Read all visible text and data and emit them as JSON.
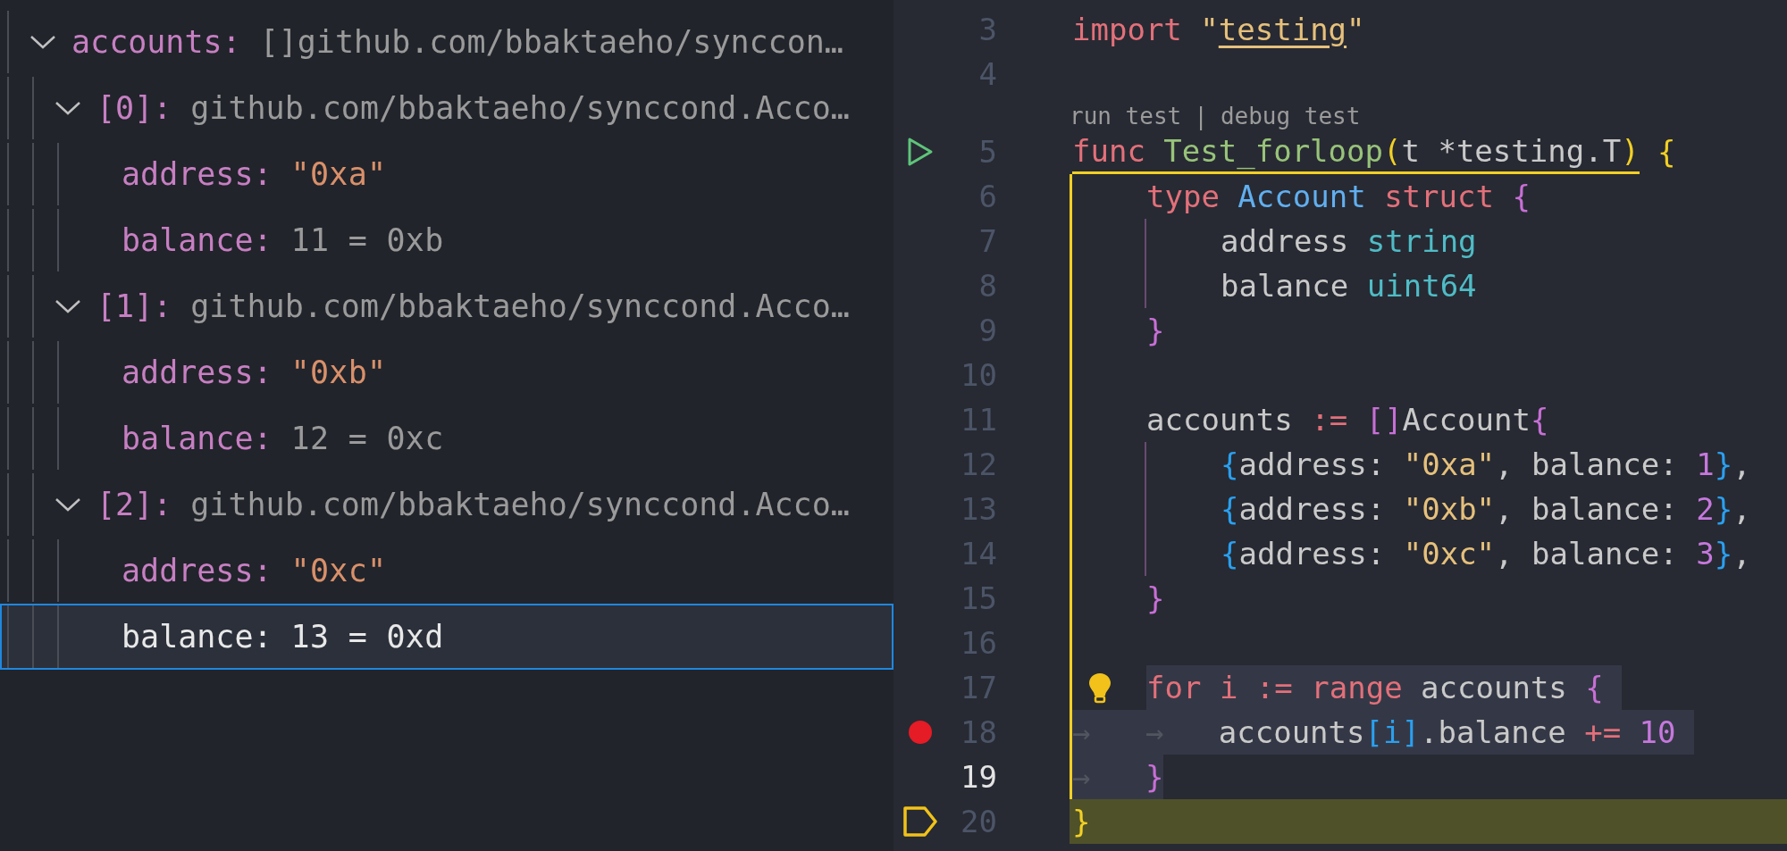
{
  "variables": [
    {
      "name": "accounts:",
      "value": "[]github.com/bbaktaeho/synccon…",
      "kind": "type",
      "expanded": true,
      "selected": false,
      "children": [
        {
          "name": "[0]:",
          "value": "github.com/bbaktaeho/synccond.Acco…",
          "kind": "type",
          "expanded": true,
          "selected": false,
          "children": [
            {
              "name": "address:",
              "value": "\"0xa\"",
              "kind": "string",
              "selected": false
            },
            {
              "name": "balance:",
              "value": "11 = 0xb",
              "kind": "number",
              "selected": false
            }
          ]
        },
        {
          "name": "[1]:",
          "value": "github.com/bbaktaeho/synccond.Acco…",
          "kind": "type",
          "expanded": true,
          "selected": false,
          "children": [
            {
              "name": "address:",
              "value": "\"0xb\"",
              "kind": "string",
              "selected": false
            },
            {
              "name": "balance:",
              "value": "12 = 0xc",
              "kind": "number",
              "selected": false
            }
          ]
        },
        {
          "name": "[2]:",
          "value": "github.com/bbaktaeho/synccond.Acco…",
          "kind": "type",
          "expanded": true,
          "selected": false,
          "children": [
            {
              "name": "address:",
              "value": "\"0xc\"",
              "kind": "string",
              "selected": false
            },
            {
              "name": "balance:",
              "value": "13 = 0xd",
              "kind": "number",
              "selected": true
            }
          ]
        }
      ]
    }
  ],
  "editor": {
    "lines": [
      {
        "number": "3",
        "tokens": [
          {
            "text": "import ",
            "kind": "keyword"
          },
          {
            "text": "\"",
            "kind": "string"
          },
          {
            "text": "testing",
            "kind": "link"
          },
          {
            "text": "\"",
            "kind": "string"
          }
        ]
      },
      {
        "number": "4"
      },
      {
        "number": "5",
        "kind": "run",
        "codelens": [
          "run test",
          "debug test"
        ],
        "codelens_separator": "|",
        "scope_start": true,
        "tokens": [
          {
            "text": "func ",
            "kind": "keyword"
          },
          {
            "text": "Test_forloop",
            "kind": "function"
          },
          {
            "text": "(",
            "kind": "paren"
          },
          {
            "text": "t *testing.T",
            "kind": "plain"
          },
          {
            "text": ")",
            "kind": "paren"
          },
          {
            "text": " {",
            "kind": "paren"
          }
        ],
        "children": [
          {
            "number": "6",
            "in_scope": true,
            "tokens": [
              {
                "text": "type ",
                "kind": "keyword"
              },
              {
                "text": "Account ",
                "kind": "type"
              },
              {
                "text": "struct ",
                "kind": "keyword"
              },
              {
                "text": "{",
                "kind": "brace"
              }
            ],
            "children": [
              {
                "number": "7",
                "in_scope": true,
                "tokens": [
                  {
                    "text": "address ",
                    "kind": "plain"
                  },
                  {
                    "text": "string",
                    "kind": "builtin"
                  }
                ]
              },
              {
                "number": "8",
                "in_scope": true,
                "tokens": [
                  {
                    "text": "balance ",
                    "kind": "plain"
                  },
                  {
                    "text": "uint64",
                    "kind": "builtin"
                  }
                ]
              }
            ]
          },
          {
            "number": "9",
            "in_scope": true,
            "tokens": [
              {
                "text": "}",
                "kind": "brace"
              }
            ]
          },
          {
            "number": "10",
            "in_scope": true
          },
          {
            "number": "11",
            "in_scope": true,
            "tokens": [
              {
                "text": "accounts ",
                "kind": "plain"
              },
              {
                "text": ":= ",
                "kind": "keyword"
              },
              {
                "text": "[]",
                "kind": "brace"
              },
              {
                "text": "Account",
                "kind": "plain"
              },
              {
                "text": "{",
                "kind": "brace"
              }
            ],
            "children": [
              {
                "number": "12",
                "in_scope": true,
                "tokens": [
                  {
                    "text": "{",
                    "kind": "bracket"
                  },
                  {
                    "text": "address: ",
                    "kind": "plain"
                  },
                  {
                    "text": "\"0xa\"",
                    "kind": "string"
                  },
                  {
                    "text": ", balance: ",
                    "kind": "plain"
                  },
                  {
                    "text": "1",
                    "kind": "number"
                  },
                  {
                    "text": "}",
                    "kind": "bracket"
                  },
                  {
                    "text": ",",
                    "kind": "plain"
                  }
                ]
              },
              {
                "number": "13",
                "in_scope": true,
                "tokens": [
                  {
                    "text": "{",
                    "kind": "bracket"
                  },
                  {
                    "text": "address: ",
                    "kind": "plain"
                  },
                  {
                    "text": "\"0xb\"",
                    "kind": "string"
                  },
                  {
                    "text": ", balance: ",
                    "kind": "plain"
                  },
                  {
                    "text": "2",
                    "kind": "number"
                  },
                  {
                    "text": "}",
                    "kind": "bracket"
                  },
                  {
                    "text": ",",
                    "kind": "plain"
                  }
                ]
              },
              {
                "number": "14",
                "in_scope": true,
                "tokens": [
                  {
                    "text": "{",
                    "kind": "bracket"
                  },
                  {
                    "text": "address: ",
                    "kind": "plain"
                  },
                  {
                    "text": "\"0xc\"",
                    "kind": "string"
                  },
                  {
                    "text": ", balance: ",
                    "kind": "plain"
                  },
                  {
                    "text": "3",
                    "kind": "number"
                  },
                  {
                    "text": "}",
                    "kind": "bracket"
                  },
                  {
                    "text": ",",
                    "kind": "plain"
                  }
                ]
              }
            ]
          },
          {
            "number": "15",
            "in_scope": true,
            "tokens": [
              {
                "text": "}",
                "kind": "brace"
              }
            ]
          },
          {
            "number": "16",
            "in_scope": true
          },
          {
            "number": "17",
            "in_scope": true,
            "lightbulb": true,
            "tokens": [
              {
                "text": "for i ",
                "kind": "keyword",
                "selected": true
              },
              {
                "text": ":= ",
                "kind": "keyword",
                "selected": true
              },
              {
                "text": "range ",
                "kind": "keyword",
                "selected": true
              },
              {
                "text": "accounts ",
                "kind": "plain",
                "selected": true
              },
              {
                "text": "{ ",
                "kind": "brace",
                "selected": true
              }
            ],
            "children": [
              {
                "number": "18",
                "in_scope": true,
                "kind": "breakpoint",
                "tokens": [
                  {
                    "text": "→   →   ",
                    "kind": "whitespace",
                    "selected": true
                  },
                  {
                    "text": "accounts",
                    "kind": "plain",
                    "selected": true
                  },
                  {
                    "text": "[i]",
                    "kind": "bracket",
                    "selected": true
                  },
                  {
                    "text": ".balance ",
                    "kind": "plain",
                    "selected": true
                  },
                  {
                    "text": "+= ",
                    "kind": "keyword",
                    "selected": true
                  },
                  {
                    "text": "10 ",
                    "kind": "number",
                    "selected": true
                  }
                ]
              }
            ]
          },
          {
            "number": "19",
            "in_scope": true,
            "current": true,
            "tokens": [
              {
                "text": "→   ",
                "kind": "whitespace",
                "selected": true
              },
              {
                "text": "}",
                "kind": "brace",
                "selected": true
              }
            ]
          }
        ]
      },
      {
        "number": "20",
        "kind": "stopped",
        "stopped": true,
        "tokens": [
          {
            "text": "}",
            "kind": "paren"
          }
        ]
      }
    ]
  }
}
